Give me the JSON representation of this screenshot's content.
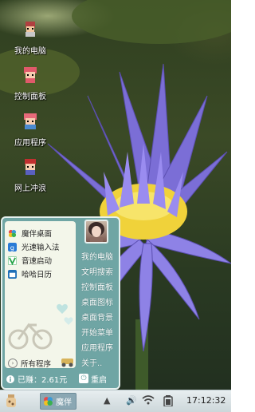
{
  "desktop": {
    "icons": [
      {
        "label": "我的电脑",
        "icon": "pixel-character-computer-icon"
      },
      {
        "label": "控制面板",
        "icon": "pixel-character-control-panel-icon"
      },
      {
        "label": "应用程序",
        "icon": "pixel-character-apps-icon"
      },
      {
        "label": "网上冲浪",
        "icon": "pixel-character-surf-icon"
      }
    ]
  },
  "start_menu": {
    "apps": [
      {
        "label": "魔伴桌面",
        "icon": "flower-icon",
        "color": "#2f8fd0"
      },
      {
        "label": "光速输入法",
        "icon": "keyboard-g-icon",
        "color": "#2a7bd6"
      },
      {
        "label": "音速启动",
        "icon": "v-logo-icon",
        "color": "#2aa64a"
      },
      {
        "label": "哈哈日历",
        "icon": "calendar-icon",
        "color": "#1e6fb8"
      }
    ],
    "all_programs": "所有程序",
    "right_items": [
      "我的电脑",
      "文明搜索",
      "控制面板",
      "桌面图标",
      "桌面背景",
      "开始菜单",
      "应用程序",
      "关于.."
    ],
    "earned": "已赚：2.61元",
    "restart": "重启",
    "accent": "#6fa5a4"
  },
  "taskbar": {
    "task_label": "魔伴",
    "clock": "17:12:32"
  }
}
